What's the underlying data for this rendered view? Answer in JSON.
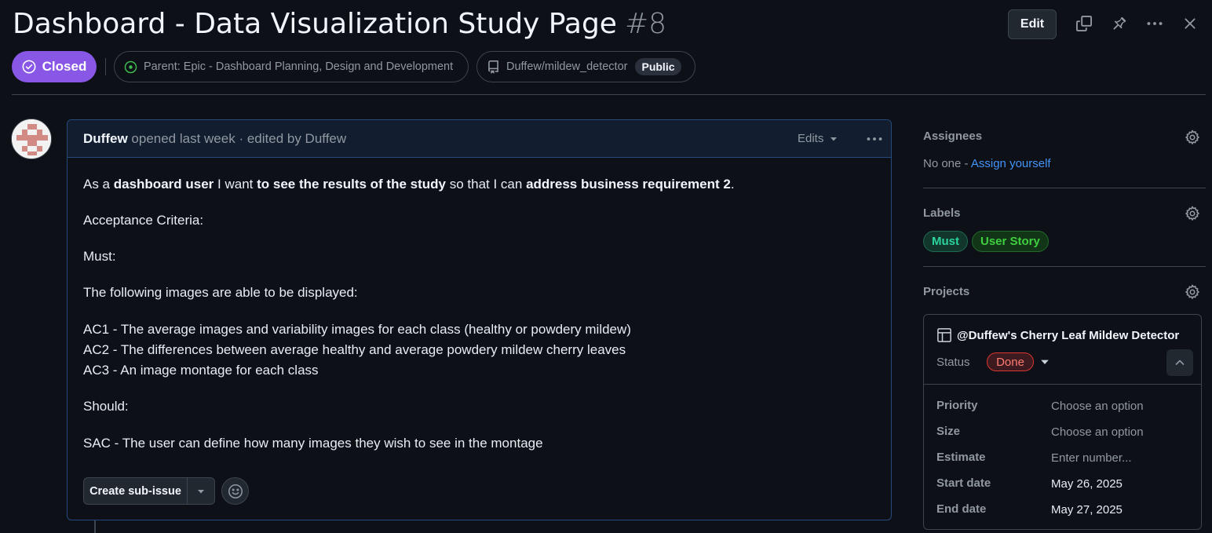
{
  "issue": {
    "title": "Dashboard - Data Visualization Study Page",
    "number": "#8",
    "state": "Closed",
    "parent": "Parent: Epic - Dashboard Planning, Design and Development",
    "repo": "Duffew/mildew_detector",
    "visibility": "Public"
  },
  "header": {
    "edit_label": "Edit"
  },
  "comment": {
    "author": "Duffew",
    "meta": "opened last week · edited by Duffew",
    "edits_label": "Edits",
    "body": {
      "p1": {
        "t1": "As a ",
        "b1": "dashboard user",
        "t2": " I want ",
        "b2": "to see the results of the study",
        "t3": " so that I can ",
        "b3": "address business requirement 2",
        "t4": "."
      },
      "acceptance": "Acceptance Criteria:",
      "must": "Must:",
      "following": "The following images are able to be displayed:",
      "ac1": "AC1 - The average images and variability images for each class (healthy or powdery mildew)",
      "ac2": "AC2 - The differences between average healthy and average powdery mildew cherry leaves",
      "ac3": "AC3 - An image montage for each class",
      "should": "Should:",
      "sac": "SAC - The user can define how many images they wish to see in the montage"
    },
    "create_subissue_label": "Create sub-issue"
  },
  "sidebar": {
    "assignees_title": "Assignees",
    "assignees_none": "No one - ",
    "assign_yourself": "Assign yourself",
    "labels_title": "Labels",
    "labels": [
      {
        "name": "Must",
        "color": "#2bd49e"
      },
      {
        "name": "User Story",
        "color": "#3fcf3f"
      }
    ],
    "projects_title": "Projects",
    "project": {
      "name": "@Duffew's Cherry Leaf Mildew Detector",
      "status_label": "Status",
      "status_value": "Done",
      "fields": [
        {
          "label": "Priority",
          "value": "Choose an option"
        },
        {
          "label": "Size",
          "value": "Choose an option"
        },
        {
          "label": "Estimate",
          "value": "Enter number..."
        },
        {
          "label": "Start date",
          "value": "May 26, 2025"
        },
        {
          "label": "End date",
          "value": "May 27, 2025"
        }
      ]
    }
  },
  "icons": {
    "header": [
      "copy-icon",
      "pin-icon",
      "kebab-horizontal-icon",
      "close-icon"
    ],
    "state": "check-circle-icon",
    "parent": "issue-open-icon",
    "repo": "repo-icon",
    "project": "table-icon",
    "settings": "gear-icon"
  }
}
